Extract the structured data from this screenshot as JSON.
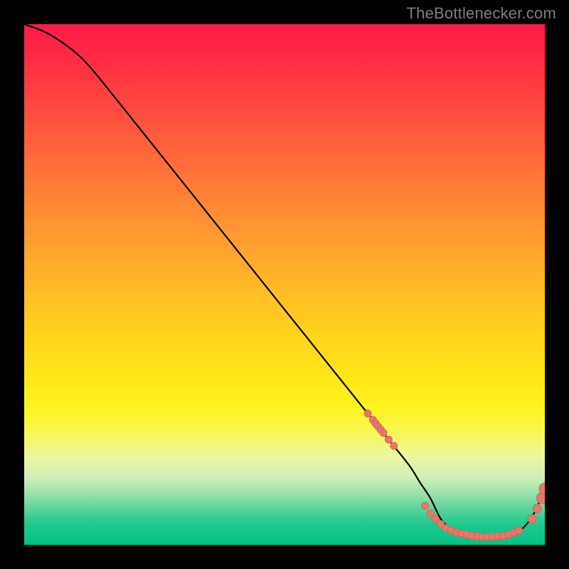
{
  "attribution": "TheBottlenecker.com",
  "colors": {
    "curve": "#000000",
    "marker_fill": "#e8776a",
    "marker_stroke": "#d7665c",
    "background": "#000000"
  },
  "chart_data": {
    "type": "line",
    "title": "",
    "xlabel": "",
    "ylabel": "",
    "xlim": [
      0,
      100
    ],
    "ylim": [
      0,
      100
    ],
    "x": [
      0,
      4,
      8,
      12,
      18,
      26,
      34,
      42,
      50,
      58,
      66,
      70,
      74,
      76,
      78,
      80,
      82,
      84,
      86,
      88,
      90,
      92,
      94,
      96,
      98,
      100
    ],
    "values": [
      100,
      98.5,
      96,
      92.5,
      85.2,
      75.2,
      65.2,
      55.2,
      45.2,
      35.2,
      25.2,
      20.2,
      15.2,
      12.0,
      9.0,
      5.0,
      3.0,
      2.2,
      1.8,
      1.6,
      1.6,
      1.8,
      2.2,
      3.4,
      6.2,
      10.8
    ],
    "markers_x": [
      66,
      67,
      67.5,
      68,
      68.5,
      69,
      70,
      71,
      77,
      78,
      79,
      80,
      81,
      82,
      83,
      84,
      85,
      86,
      87,
      88,
      89,
      90,
      91,
      92,
      93,
      94,
      95,
      97.5,
      98.5,
      99.5,
      100
    ],
    "markers_y": [
      25.2,
      24.0,
      23.3,
      22.7,
      22.1,
      21.5,
      20.2,
      19.0,
      7.5,
      6.0,
      5.0,
      4.0,
      3.2,
      2.8,
      2.4,
      2.2,
      2.0,
      1.8,
      1.7,
      1.6,
      1.6,
      1.6,
      1.7,
      1.8,
      2.0,
      2.4,
      2.8,
      5.0,
      7.0,
      9.0,
      10.8
    ],
    "markers_r": [
      5,
      5,
      5,
      5,
      5,
      5,
      5,
      5,
      5,
      5,
      5,
      5,
      5,
      5,
      5,
      5,
      5,
      5,
      5,
      5,
      5,
      5,
      5,
      5,
      5,
      5,
      5,
      6,
      6,
      8,
      8
    ]
  }
}
